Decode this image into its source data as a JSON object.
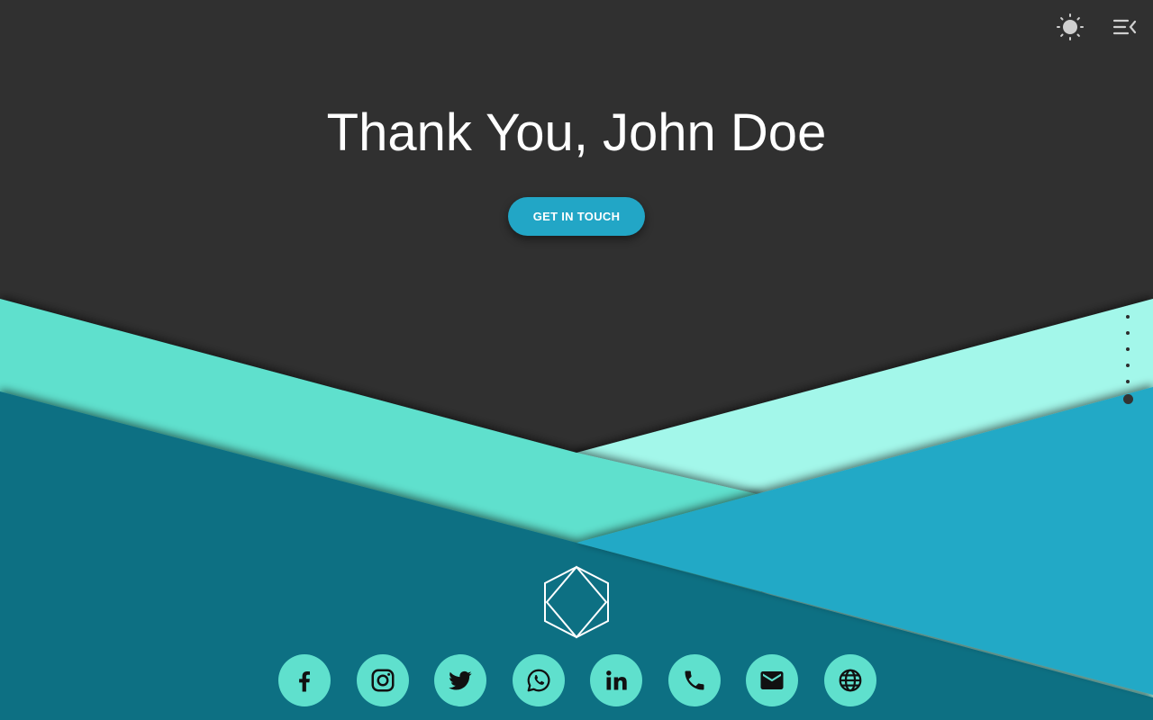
{
  "hero": {
    "title": "Thank You, John Doe",
    "cta_label": "GET IN TOUCH"
  },
  "topbar": {
    "theme_icon": "sun-icon",
    "menu_icon": "menu-collapse-icon"
  },
  "section_nav": {
    "dot_count": 6,
    "active_index": 5
  },
  "logo": {
    "icon": "hexagon-diamond-logo"
  },
  "social_links": [
    {
      "name": "facebook",
      "icon": "facebook-icon"
    },
    {
      "name": "instagram",
      "icon": "instagram-icon"
    },
    {
      "name": "twitter",
      "icon": "twitter-icon"
    },
    {
      "name": "whatsapp",
      "icon": "whatsapp-icon"
    },
    {
      "name": "linkedin",
      "icon": "linkedin-icon"
    },
    {
      "name": "phone",
      "icon": "phone-icon"
    },
    {
      "name": "email",
      "icon": "email-icon"
    },
    {
      "name": "website",
      "icon": "globe-icon"
    }
  ],
  "colors": {
    "background_dark": "#303030",
    "mint": "#5fe0cd",
    "mint_light": "#a3f7ea",
    "teal_dark": "#0d7083",
    "cyan": "#22a9c6",
    "button": "#22a6c6"
  }
}
